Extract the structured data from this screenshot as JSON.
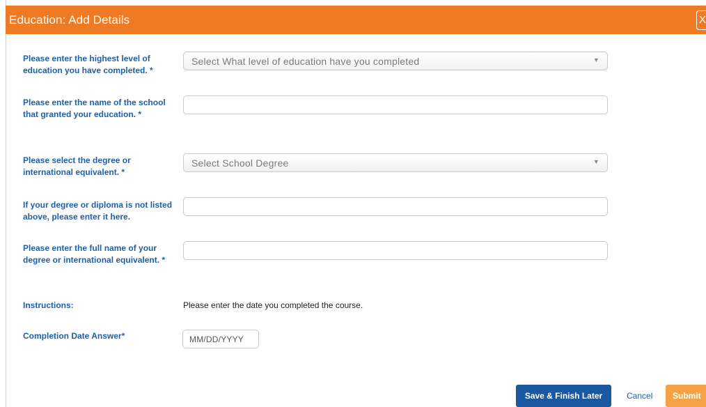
{
  "header": {
    "title": "Education: Add Details",
    "close_glyph": "X"
  },
  "fields": [
    {
      "label": "Please enter the highest level of education you have completed. *",
      "type": "select",
      "value": "Select What level of education have you completed"
    },
    {
      "label": "Please enter the name of the school that granted your education. *",
      "type": "text",
      "value": ""
    },
    {
      "label": "Please select the degree or international equivalent. *",
      "type": "select",
      "value": "Select School Degree"
    },
    {
      "label": "If your degree or diploma is not listed above, please enter it here.",
      "type": "text",
      "value": ""
    },
    {
      "label": "Please enter the full name of your degree or international equivalent. *",
      "type": "text",
      "value": ""
    }
  ],
  "instructions": {
    "label": "Instructions:",
    "text": "Please enter the date you completed the course."
  },
  "completion_date": {
    "label": "Completion Date Answer*",
    "placeholder": "MM/DD/YYYY"
  },
  "actions": {
    "save_label": "Save & Finish Later",
    "cancel_label": "Cancel",
    "submit_label": "Submit"
  },
  "colors": {
    "header_bg": "#ee7a24",
    "label_text": "#1f5fa8",
    "save_button": "#1a58a2",
    "submit_button": "#f5a247"
  }
}
